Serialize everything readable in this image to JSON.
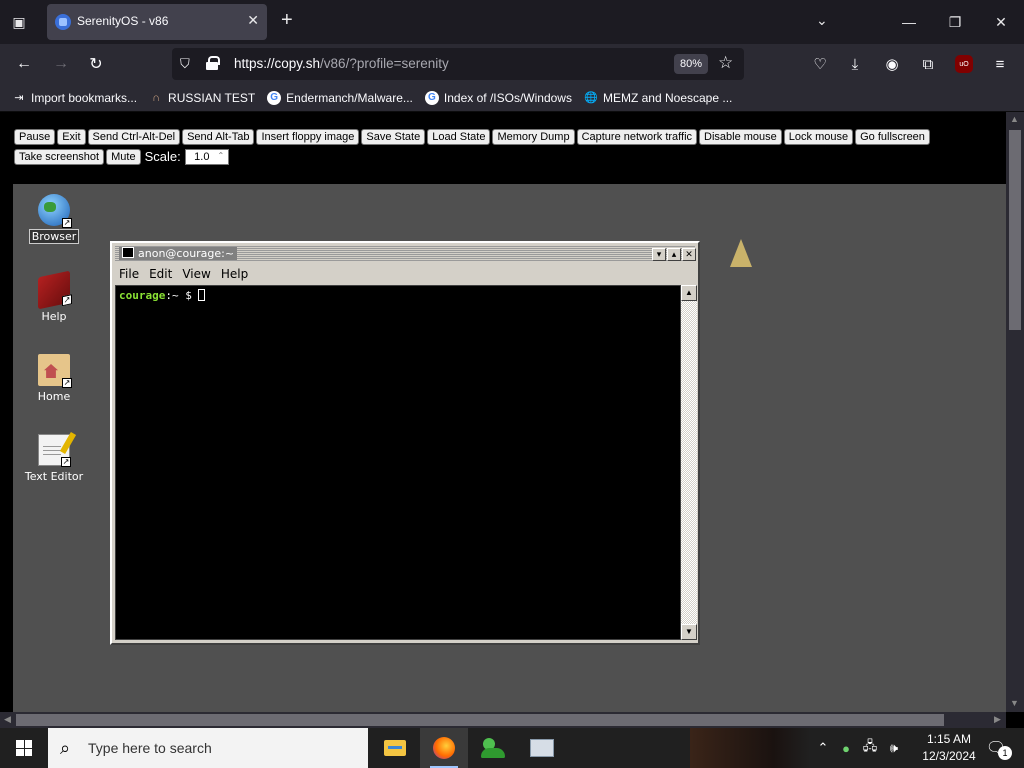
{
  "browser": {
    "tab_title": "SerenityOS - v86",
    "url_host": "https://copy.sh",
    "url_path": "/v86/?profile=serenity",
    "zoom": "80%",
    "bookmarks": [
      {
        "label": "Import bookmarks...",
        "icon": "import-icon"
      },
      {
        "label": "RUSSIAN TEST",
        "icon": "headphones-icon"
      },
      {
        "label": "Endermanch/Malware...",
        "icon": "google-icon"
      },
      {
        "label": "Index of /ISOs/Windows",
        "icon": "google-icon"
      },
      {
        "label": "MEMZ and Noescape ...",
        "icon": "globe-icon"
      }
    ]
  },
  "controls": {
    "buttons": [
      "Pause",
      "Exit",
      "Send Ctrl-Alt-Del",
      "Send Alt-Tab",
      "Insert floppy image",
      "Save State",
      "Load State",
      "Memory Dump",
      "Capture network traffic",
      "Disable mouse",
      "Lock mouse",
      "Go fullscreen",
      "Take screenshot",
      "Mute"
    ],
    "scale_label": "Scale:",
    "scale_value": "1.0"
  },
  "desktop": {
    "icons": [
      {
        "label": "Browser",
        "icon": "browser-globe-icon"
      },
      {
        "label": "Help",
        "icon": "help-book-icon"
      },
      {
        "label": "Home",
        "icon": "home-folder-icon"
      },
      {
        "label": "Text Editor",
        "icon": "text-editor-icon"
      }
    ]
  },
  "terminal": {
    "title": "anon@courage:~",
    "menus": [
      "File",
      "Edit",
      "View",
      "Help"
    ],
    "prompt_host": "courage",
    "prompt_rest": ":~ $ "
  },
  "taskbar": {
    "search_placeholder": "Type here to search",
    "time": "1:15 AM",
    "date": "12/3/2024",
    "notification_count": "1"
  }
}
